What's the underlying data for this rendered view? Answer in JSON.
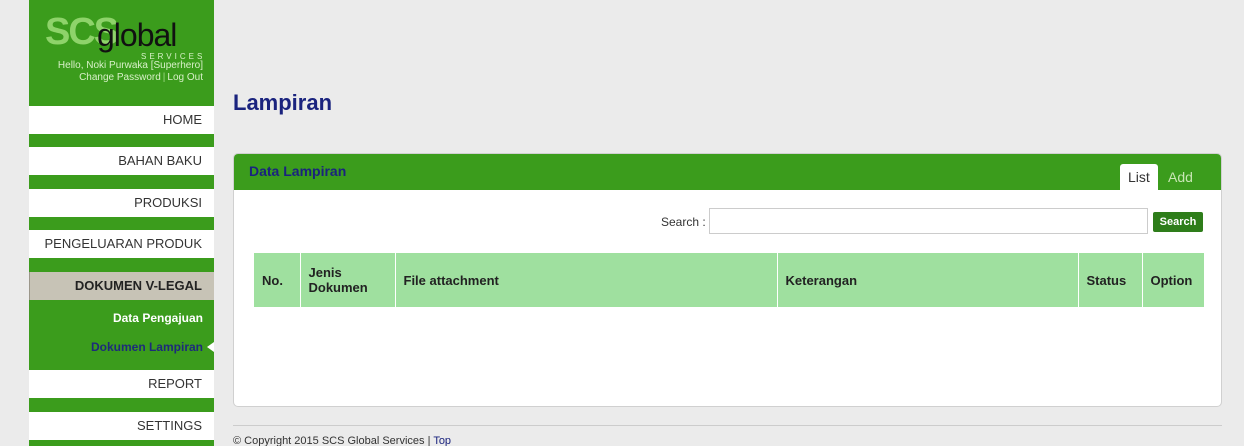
{
  "brand": {
    "scs": "SCS",
    "global": "global",
    "services": "SERVICES"
  },
  "user": {
    "greeting": "Hello, Noki Purwaka [Superhero]",
    "change_password": "Change Password",
    "separator": "|",
    "log_out": "Log Out"
  },
  "menu": {
    "home": "HOME",
    "bahan_baku": "BAHAN BAKU",
    "produksi": "PRODUKSI",
    "pengeluaran": "PENGELUARAN PRODUK",
    "dokumen": "DOKUMEN V-LEGAL",
    "sub_pengajuan": "Data Pengajuan",
    "sub_lampiran": "Dokumen Lampiran",
    "report": "REPORT",
    "settings": "SETTINGS"
  },
  "page": {
    "title": "Lampiran"
  },
  "panel": {
    "title": "Data Lampiran",
    "tab_list": "List",
    "tab_add": "Add",
    "search_label": "Search :",
    "search_value": "",
    "search_button": "Search"
  },
  "table": {
    "headers": [
      "No.",
      "Jenis Dokumen",
      "File attachment",
      "Keterangan",
      "Status",
      "Option"
    ],
    "rows": []
  },
  "footer": {
    "copyright": "© Copyright 2015 SCS Global Services |",
    "top": "Top"
  },
  "colors": {
    "sidebar": "#3b9c1c",
    "header_row": "#9fe09f",
    "title": "#1a237e",
    "button": "#2e7d1a"
  }
}
